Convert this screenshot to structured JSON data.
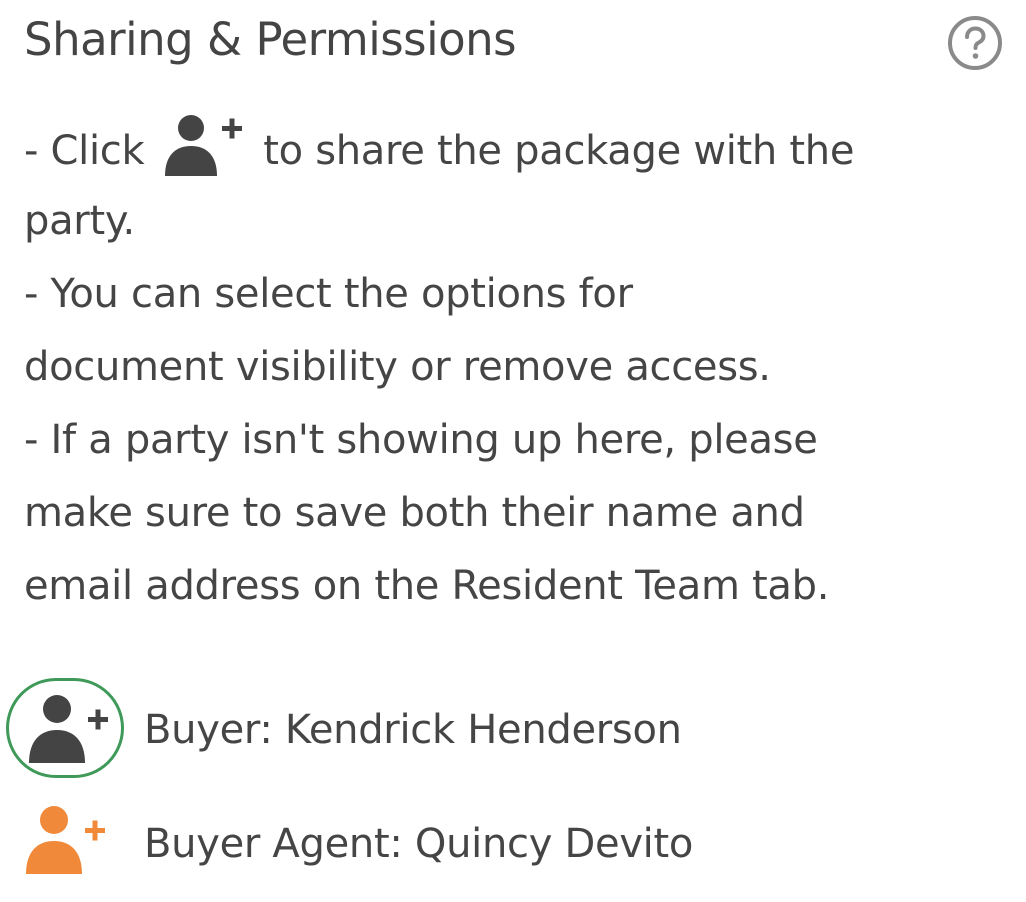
{
  "panel": {
    "title": "Sharing & Permissions",
    "help_icon": "question-circle-icon"
  },
  "instructions": {
    "line1_before": "- Click",
    "line1_icon": "user-plus-icon",
    "line1_after": "to share the package with the",
    "line2": "party.",
    "line3": "- You can select the options for",
    "line4": "document visibility or remove access.",
    "line5": "- If a party isn't showing up here, please",
    "line6": "make sure to save both their name and",
    "line7": "email address on the Resident Team tab."
  },
  "parties": [
    {
      "label": "Buyer: Kendrick Henderson",
      "icon": "user-plus-icon",
      "icon_color": "#444444",
      "highlighted": true,
      "highlight_color": "#3f9a5a"
    },
    {
      "label": "Buyer Agent: Quincy Devito",
      "icon": "user-plus-icon",
      "icon_color": "#f08a3a",
      "highlighted": false
    }
  ],
  "colors": {
    "text": "#454545",
    "help_icon": "#8a8a8a",
    "shared_icon": "#f08a3a",
    "unshared_icon": "#444444"
  }
}
